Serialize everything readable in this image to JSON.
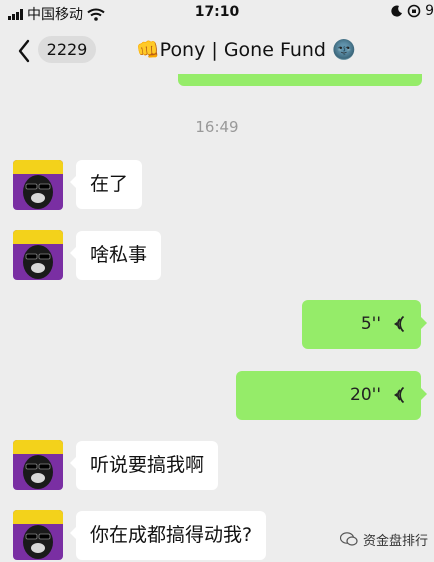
{
  "status_bar": {
    "carrier": "中国移动",
    "time": "17:10",
    "battery_partial": "9"
  },
  "nav": {
    "unread_count": "2229",
    "title": "👊Pony | Gone Fund 🌚"
  },
  "timestamp": "16:49",
  "messages": [
    {
      "side": "left",
      "type": "text",
      "text": "在了"
    },
    {
      "side": "left",
      "type": "text",
      "text": "啥私事"
    },
    {
      "side": "right",
      "type": "voice",
      "duration": "5''"
    },
    {
      "side": "right",
      "type": "voice",
      "duration": "20''"
    },
    {
      "side": "left",
      "type": "text",
      "text": "听说要搞我啊"
    },
    {
      "side": "left",
      "type": "text",
      "text": "你在成都搞得动我?"
    }
  ],
  "watermark": "资金盘排行",
  "colors": {
    "background": "#ededed",
    "self_bubble": "#95ec69",
    "other_bubble": "#ffffff",
    "timestamp": "#999999"
  },
  "icons": [
    "back-arrow-icon",
    "wifi-icon",
    "moon-icon",
    "orientation-lock-icon",
    "voice-wave-icon",
    "wechat-icon"
  ]
}
